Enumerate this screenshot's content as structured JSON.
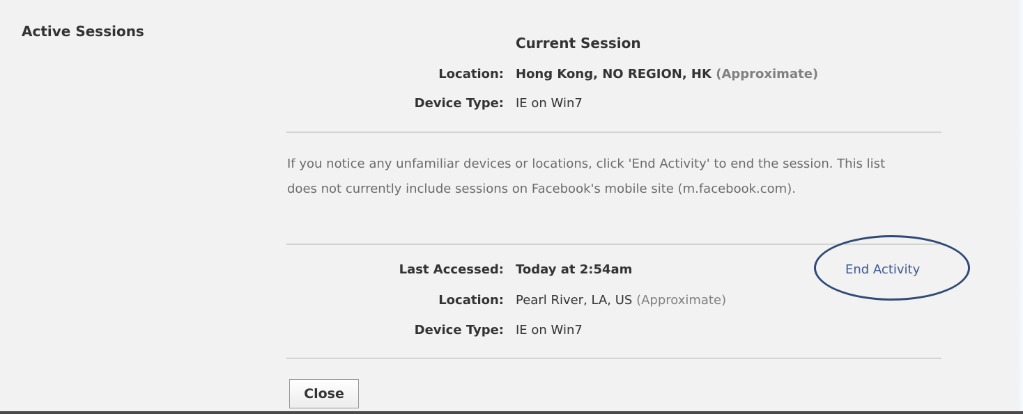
{
  "section_title": "Active Sessions",
  "current_session": {
    "heading": "Current Session",
    "location_label": "Location:",
    "location_value": "Hong Kong, NO REGION, HK",
    "location_note": "(Approximate)",
    "device_label": "Device Type:",
    "device_value": "IE on Win7"
  },
  "notice": "If you notice any unfamiliar devices or locations, click 'End Activity' to end the session. This list does not currently include sessions on Facebook's mobile site (m.facebook.com).",
  "other_session": {
    "last_accessed_label": "Last Accessed:",
    "last_accessed_value": "Today at 2:54am",
    "end_activity_label": "End Activity",
    "location_label": "Location:",
    "location_value": "Pearl River, LA, US",
    "location_note": "(Approximate)",
    "device_label": "Device Type:",
    "device_value": "IE on Win7"
  },
  "close_label": "Close",
  "colors": {
    "link": "#3b5998",
    "highlight_ring": "#2e4a78",
    "muted_text": "#808080"
  }
}
